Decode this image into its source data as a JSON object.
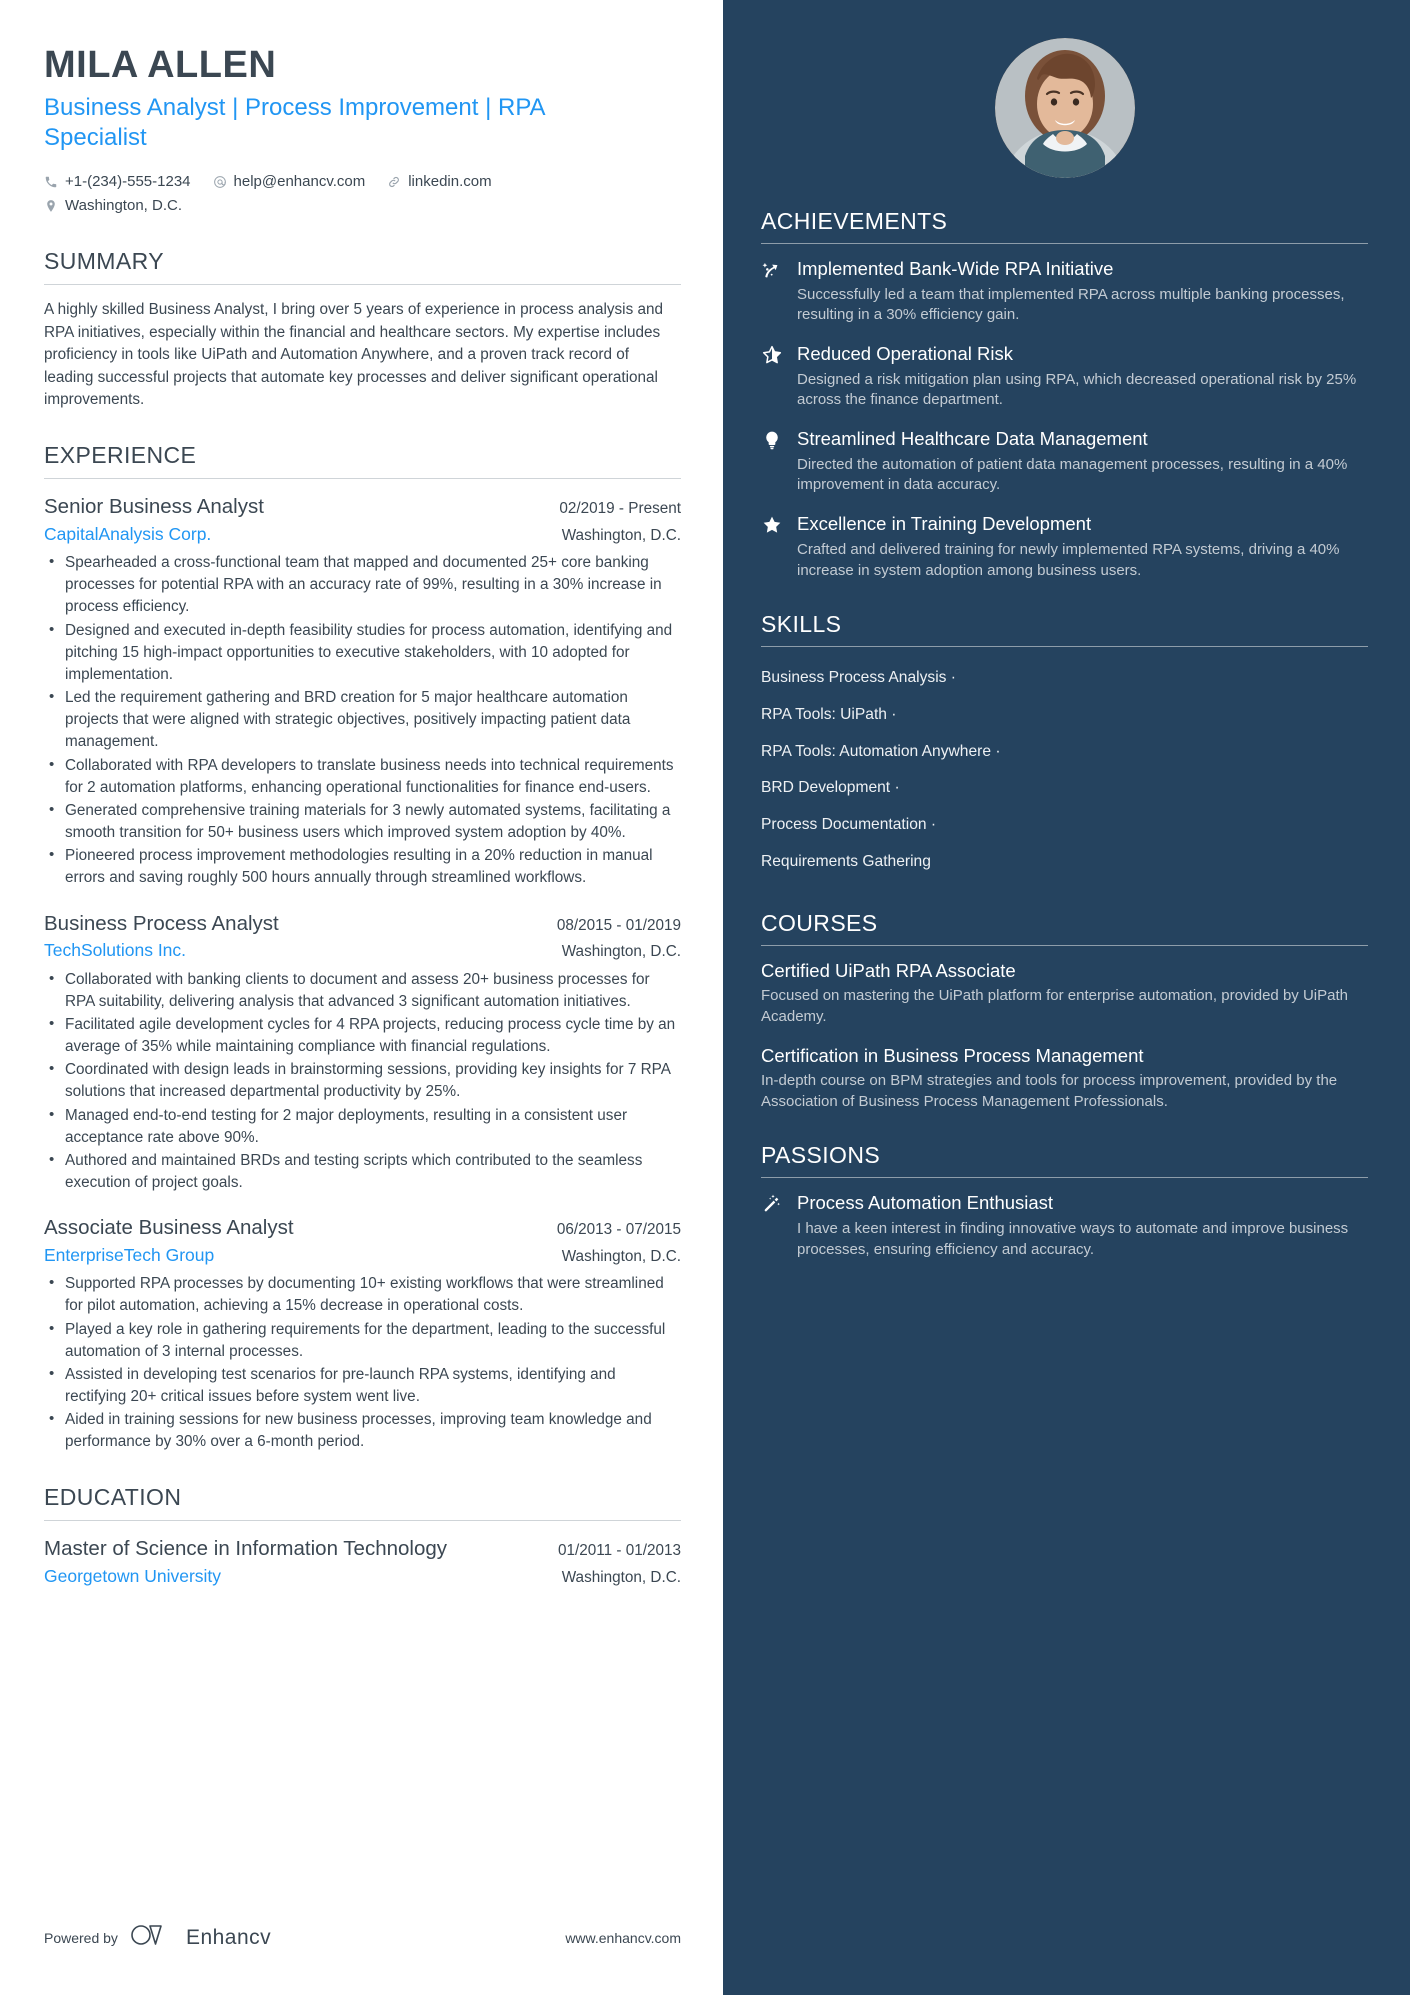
{
  "header": {
    "name": "MILA ALLEN",
    "headline": "Business Analyst | Process Improvement | RPA Specialist",
    "contacts": [
      {
        "icon": "phone-icon",
        "text": "+1-(234)-555-1234"
      },
      {
        "icon": "email-icon",
        "text": "help@enhancv.com"
      },
      {
        "icon": "link-icon",
        "text": "linkedin.com"
      },
      {
        "icon": "location-icon",
        "text": "Washington, D.C."
      }
    ]
  },
  "summary": {
    "title": "SUMMARY",
    "text": "A highly skilled Business Analyst, I bring over 5 years of experience in process analysis and RPA initiatives, especially within the financial and healthcare sectors. My expertise includes proficiency in tools like UiPath and Automation Anywhere, and a proven track record of leading successful projects that automate key processes and deliver significant operational improvements."
  },
  "experience": {
    "title": "EXPERIENCE",
    "jobs": [
      {
        "title": "Senior Business Analyst",
        "dates": "02/2019 - Present",
        "company": "CapitalAnalysis Corp.",
        "location": "Washington, D.C.",
        "bullets": [
          "Spearheaded a cross-functional team that mapped and documented 25+ core banking processes for potential RPA with an accuracy rate of 99%, resulting in a 30% increase in process efficiency.",
          "Designed and executed in-depth feasibility studies for process automation, identifying and pitching 15 high-impact opportunities to executive stakeholders, with 10 adopted for implementation.",
          "Led the requirement gathering and BRD creation for 5 major healthcare automation projects that were aligned with strategic objectives, positively impacting patient data management.",
          "Collaborated with RPA developers to translate business needs into technical requirements for 2 automation platforms, enhancing operational functionalities for finance end-users.",
          "Generated comprehensive training materials for 3 newly automated systems, facilitating a smooth transition for 50+ business users which improved system adoption by 40%.",
          "Pioneered process improvement methodologies resulting in a 20% reduction in manual errors and saving roughly 500 hours annually through streamlined workflows."
        ]
      },
      {
        "title": "Business Process Analyst",
        "dates": "08/2015 - 01/2019",
        "company": "TechSolutions Inc.",
        "location": "Washington, D.C.",
        "bullets": [
          "Collaborated with banking clients to document and assess 20+ business processes for RPA suitability, delivering analysis that advanced 3 significant automation initiatives.",
          "Facilitated agile development cycles for 4 RPA projects, reducing process cycle time by an average of 35% while maintaining compliance with financial regulations.",
          "Coordinated with design leads in brainstorming sessions, providing key insights for 7 RPA solutions that increased departmental productivity by 25%.",
          "Managed end-to-end testing for 2 major deployments, resulting in a consistent user acceptance rate above 90%.",
          "Authored and maintained BRDs and testing scripts which contributed to the seamless execution of project goals."
        ]
      },
      {
        "title": "Associate Business Analyst",
        "dates": "06/2013 - 07/2015",
        "company": "EnterpriseTech Group",
        "location": "Washington, D.C.",
        "bullets": [
          "Supported RPA processes by documenting 10+ existing workflows that were streamlined for pilot automation, achieving a 15% decrease in operational costs.",
          "Played a key role in gathering requirements for the department, leading to the successful automation of 3 internal processes.",
          "Assisted in developing test scenarios for pre-launch RPA systems, identifying and rectifying 20+ critical issues before system went live.",
          "Aided in training sessions for new business processes, improving team knowledge and performance by 30% over a 6-month period."
        ]
      }
    ]
  },
  "education": {
    "title": "EDUCATION",
    "entries": [
      {
        "degree": "Master of Science in Information Technology",
        "dates": "01/2011 - 01/2013",
        "school": "Georgetown University",
        "location": "Washington, D.C."
      }
    ]
  },
  "footer": {
    "powered_label": "Powered by",
    "brand": "Enhancv",
    "site": "www.enhancv.com"
  },
  "sidebar": {
    "achievements": {
      "title": "ACHIEVEMENTS",
      "items": [
        {
          "icon": "shooting-star-icon",
          "title": "Implemented Bank-Wide RPA Initiative",
          "desc": "Successfully led a team that implemented RPA across multiple banking processes, resulting in a 30% efficiency gain."
        },
        {
          "icon": "half-star-icon",
          "title": "Reduced Operational Risk",
          "desc": "Designed a risk mitigation plan using RPA, which decreased operational risk by 25% across the finance department."
        },
        {
          "icon": "lightbulb-icon",
          "title": "Streamlined Healthcare Data Management",
          "desc": "Directed the automation of patient data management processes, resulting in a 40% improvement in data accuracy."
        },
        {
          "icon": "star-icon",
          "title": "Excellence in Training Development",
          "desc": "Crafted and delivered training for newly implemented RPA systems, driving a 40% increase in system adoption among business users."
        }
      ]
    },
    "skills": {
      "title": "SKILLS",
      "items": [
        "Business Process Analysis ·",
        "RPA Tools: UiPath ·",
        "RPA Tools: Automation Anywhere ·",
        "BRD Development ·",
        "Process Documentation ·",
        "Requirements Gathering"
      ]
    },
    "courses": {
      "title": "COURSES",
      "items": [
        {
          "title": "Certified UiPath RPA Associate",
          "desc": "Focused on mastering the UiPath platform for enterprise automation, provided by UiPath Academy."
        },
        {
          "title": "Certification in Business Process Management",
          "desc": "In-depth course on BPM strategies and tools for process improvement, provided by the Association of Business Process Management Professionals."
        }
      ]
    },
    "passions": {
      "title": "PASSIONS",
      "items": [
        {
          "icon": "magic-wand-icon",
          "title": "Process Automation Enthusiast",
          "desc": "I have a keen interest in finding innovative ways to automate and improve business processes, ensuring efficiency and accuracy."
        }
      ]
    }
  },
  "colors": {
    "accent": "#2196f3",
    "sidebar_bg": "#25435f",
    "text": "#3b4752"
  }
}
